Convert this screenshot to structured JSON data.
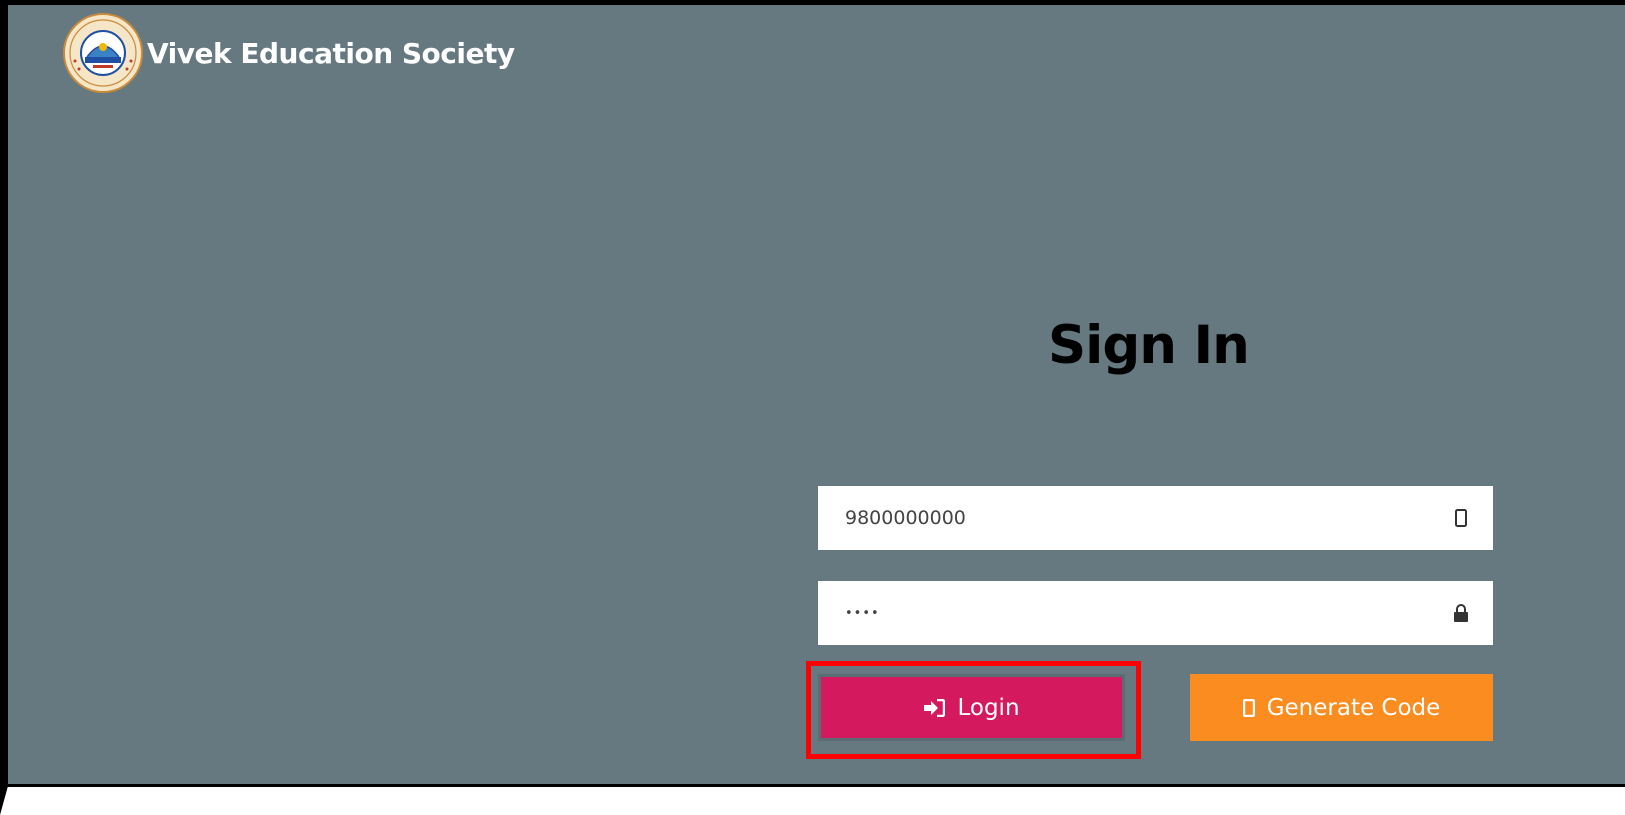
{
  "header": {
    "brand_name": "Vivek Education Society",
    "logo_icon": "vivek-education-society-logo"
  },
  "signin": {
    "title": "Sign In",
    "phone_field": {
      "value": "9800000000",
      "icon": "mobile-icon"
    },
    "password_field": {
      "value": "••••",
      "icon": "lock-icon"
    },
    "login_button": {
      "label": "Login",
      "icon": "sign-in-icon",
      "color": "#d5195f"
    },
    "generate_button": {
      "label": "Generate Code",
      "icon": "mobile-icon",
      "color": "#fb8c1f"
    }
  },
  "colors": {
    "background": "#667981",
    "highlight": "#ff0000"
  }
}
